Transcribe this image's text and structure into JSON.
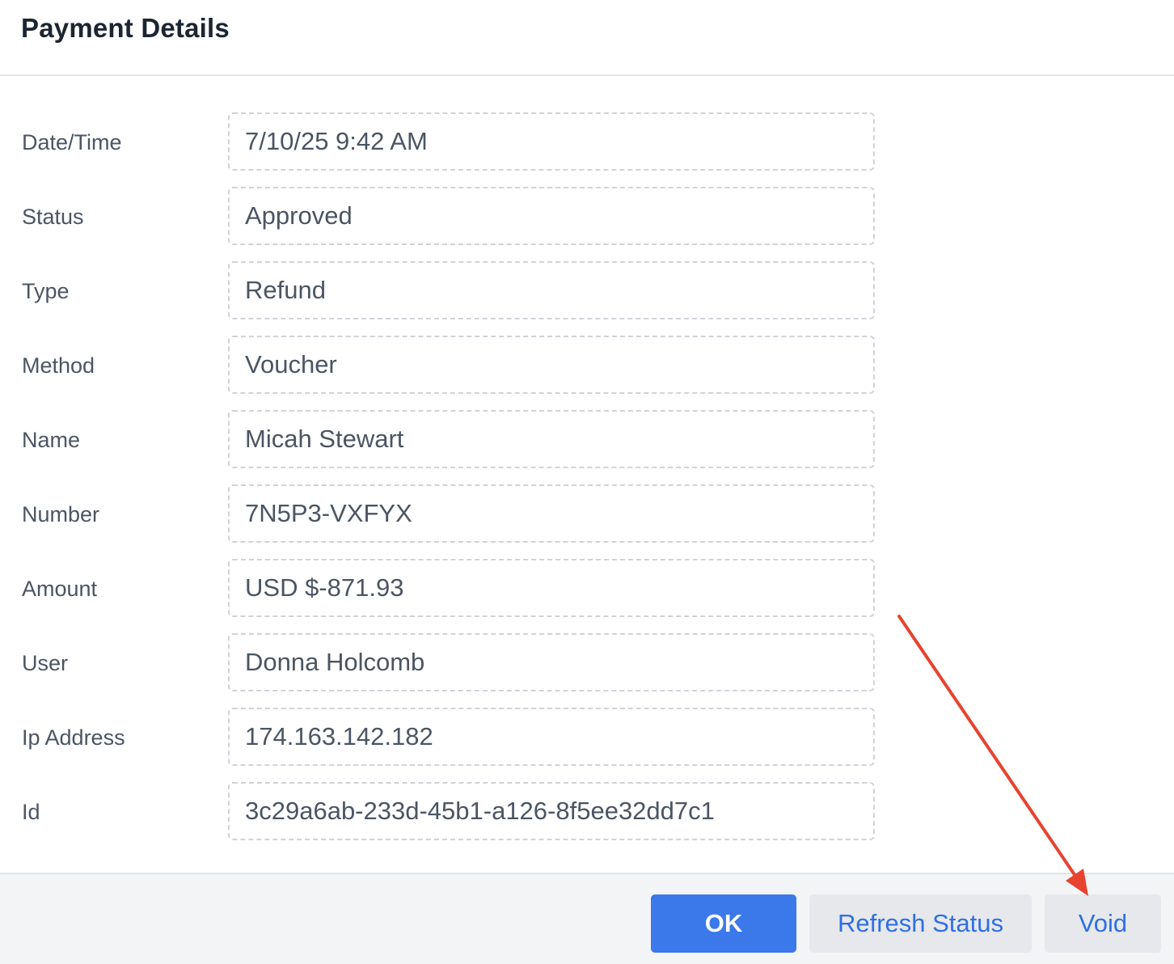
{
  "dialog": {
    "title": "Payment Details"
  },
  "fields": [
    {
      "label": "Date/Time",
      "value": "7/10/25 9:42 AM"
    },
    {
      "label": "Status",
      "value": "Approved"
    },
    {
      "label": "Type",
      "value": "Refund"
    },
    {
      "label": "Method",
      "value": "Voucher"
    },
    {
      "label": "Name",
      "value": "Micah Stewart"
    },
    {
      "label": "Number",
      "value": "7N5P3-VXFYX"
    },
    {
      "label": "Amount",
      "value": "USD $-871.93"
    },
    {
      "label": "User",
      "value": "Donna Holcomb"
    },
    {
      "label": "Ip Address",
      "value": "174.163.142.182"
    },
    {
      "label": "Id",
      "value": "3c29a6ab-233d-45b1-a126-8f5ee32dd7c1"
    }
  ],
  "footer": {
    "ok_label": "OK",
    "refresh_label": "Refresh Status",
    "void_label": "Void"
  },
  "colors": {
    "primary": "#3b78ea",
    "link": "#2f6fe4",
    "annotation_arrow": "#e8432e"
  }
}
